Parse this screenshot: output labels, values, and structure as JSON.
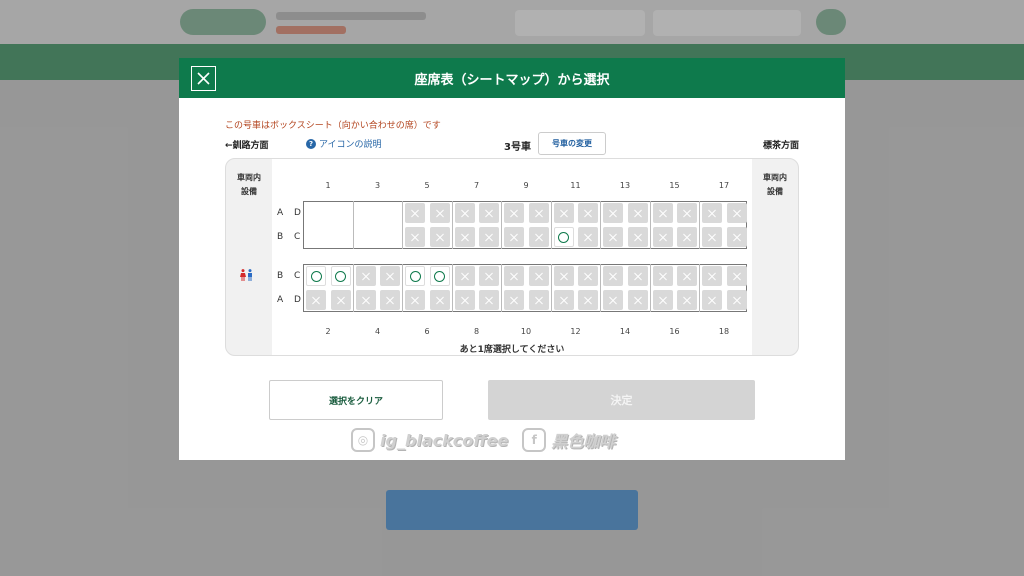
{
  "modal": {
    "title": "座席表（シートマップ）から選択",
    "box_note": "この号車はボックスシート（向かい合わせの席）です",
    "direction_left": "←釧路方面",
    "icon_help": "アイコンの説明",
    "car_number": "3号車",
    "change_car": "号車の変更",
    "direction_right": "標茶方面",
    "facility_label": "車両内\n設備",
    "remaining": "あと1席選択してください",
    "clear_button": "選択をクリア",
    "decide_button": "決定"
  },
  "seatmap": {
    "top_row_numbers": [
      "1",
      "3",
      "5",
      "7",
      "9",
      "11",
      "13",
      "15",
      "17"
    ],
    "bottom_row_numbers": [
      "2",
      "4",
      "6",
      "8",
      "10",
      "12",
      "14",
      "16",
      "18"
    ],
    "top_rows": [
      "A D",
      "B C"
    ],
    "bottom_rows": [
      "B C",
      "A D"
    ],
    "upper_BC_free_columns": [
      2,
      10
    ],
    "lower_BC_free_columns": [
      0,
      1,
      4,
      5
    ],
    "colors": {
      "accent": "#0e7a4c",
      "taken": "#d9d9d9",
      "note": "#b3451f"
    }
  },
  "watermark": {
    "instagram": "ig_blackcoffee",
    "facebook": "黑色咖啡"
  }
}
